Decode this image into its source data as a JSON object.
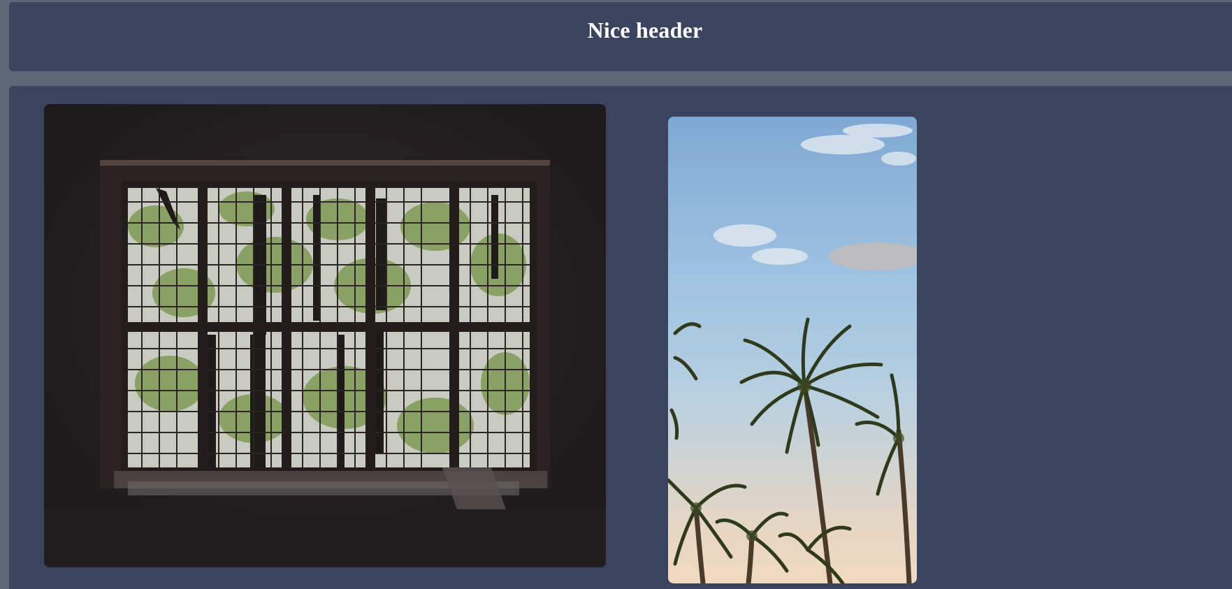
{
  "header": {
    "title": "Nice header"
  },
  "gallery": {
    "images": [
      {
        "name": "dark-window-photo",
        "description_icon": "window-with-trees"
      },
      {
        "name": "palm-trees-photo",
        "description_icon": "palm-trees-sky"
      }
    ]
  },
  "colors": {
    "page_background": "#5b6878",
    "panel_background": "#3a445f",
    "header_text": "#ffffff"
  }
}
